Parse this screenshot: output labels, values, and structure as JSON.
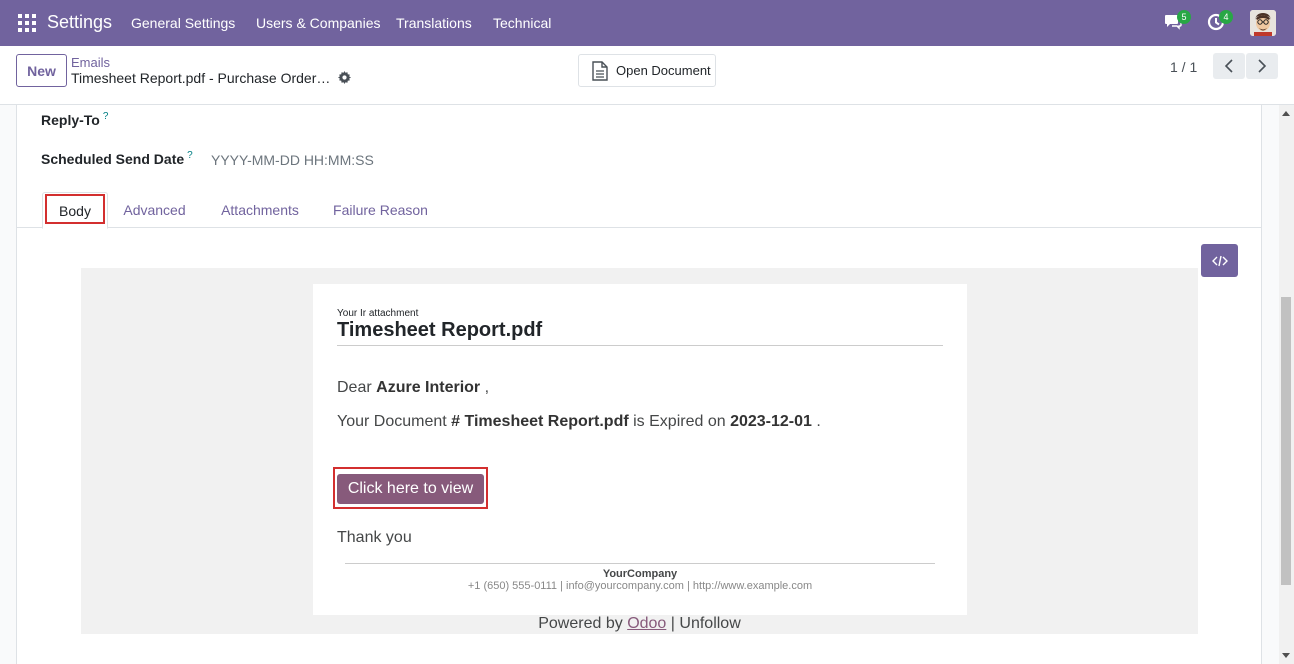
{
  "navbar": {
    "app_name": "Settings",
    "menu": [
      "General Settings",
      "Users & Companies",
      "Translations",
      "Technical"
    ],
    "messages_count": "5",
    "activities_count": "4"
  },
  "control": {
    "new_label": "New",
    "breadcrumb_parent": "Emails",
    "breadcrumb_current": "Timesheet Report.pdf - Purchase Order Expiry",
    "open_document_label": "Open Document",
    "pager": "1 / 1"
  },
  "form": {
    "reply_to_label": "Reply-To",
    "scheduled_label": "Scheduled Send Date",
    "scheduled_placeholder": "YYYY-MM-DD HH:MM:SS",
    "help_mark": "?",
    "tabs": [
      "Body",
      "Advanced",
      "Attachments",
      "Failure Reason"
    ]
  },
  "email": {
    "subtitle": "Your Ir attachment",
    "title": "Timesheet Report.pdf",
    "dear": "Dear",
    "customer": "Azure Interior",
    "comma": ",",
    "doc_prefix": "Your Document",
    "doc_name": "# Timesheet Report.pdf",
    "expired_on": "is Expired on",
    "expiry_date": "2023-12-01",
    "period": ".",
    "button_label": "Click here to view",
    "thanks": "Thank you",
    "company_name": "YourCompany",
    "company_info": "+1 (650) 555-0111 | info@yourcompany.com | http://www.example.com",
    "powered_by": "Powered by",
    "odoo": "Odoo",
    "separator": "|",
    "unfollow": "Unfollow"
  },
  "colors": {
    "brand": "#71639e",
    "email_button": "#875a7b",
    "highlight": "#d32f2f",
    "badge": "#28a745"
  }
}
